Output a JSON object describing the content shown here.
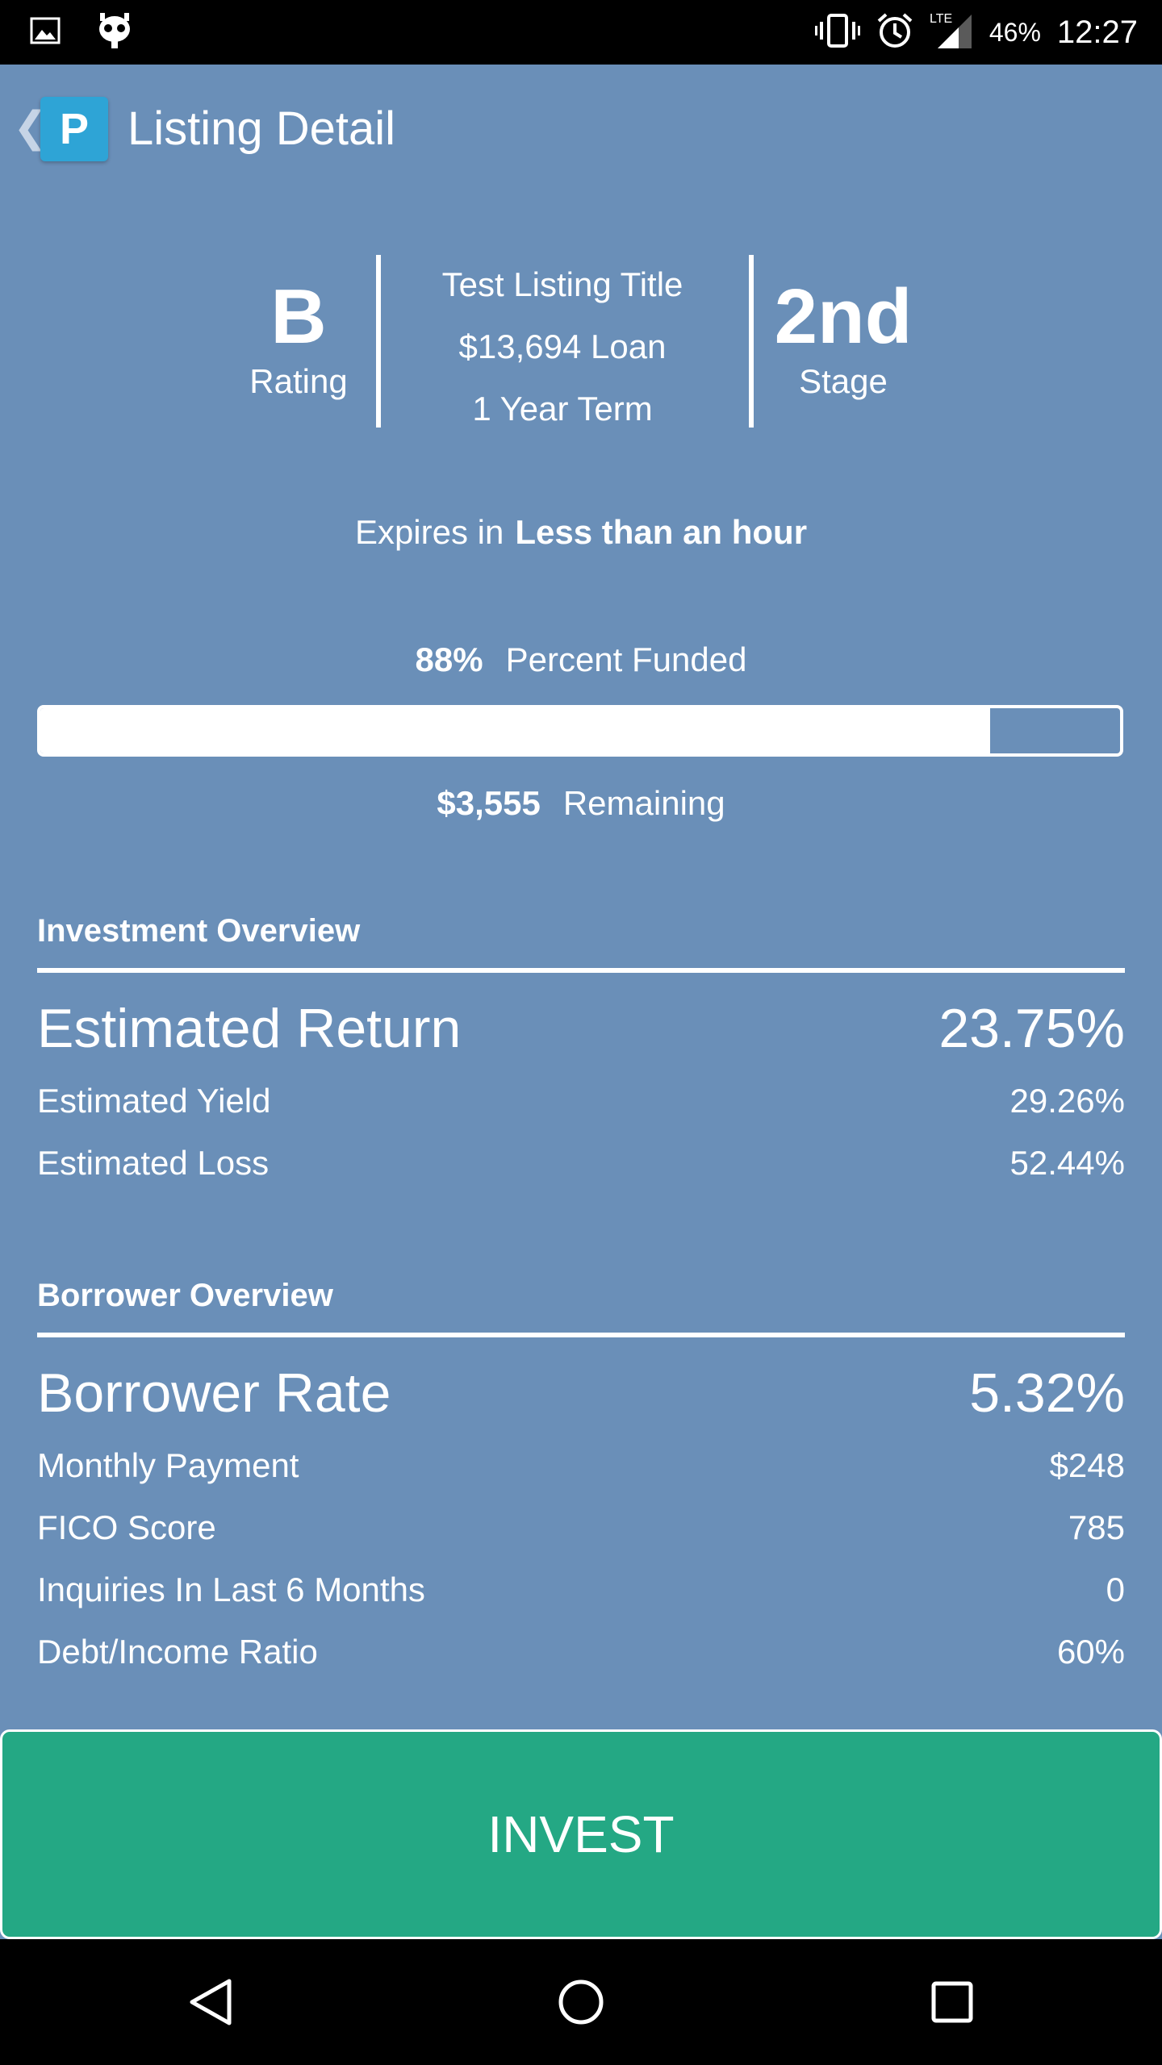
{
  "status_bar": {
    "icons": [
      "image-icon",
      "cyanogen-icon",
      "vibrate-icon",
      "alarm-icon",
      "lte-signal-icon"
    ],
    "network": "LTE",
    "battery": "46%",
    "time": "12:27"
  },
  "app_bar": {
    "logo_letter": "P",
    "title": "Listing Detail"
  },
  "summary": {
    "rating_value": "B",
    "rating_label": "Rating",
    "listing_title": "Test Listing Title",
    "loan_text": "$13,694 Loan",
    "term_text": "1 Year Term",
    "stage_value": "2nd",
    "stage_label": "Stage"
  },
  "expires": {
    "prefix": "Expires in",
    "value": "Less than an hour"
  },
  "funding": {
    "percent_text": "88%",
    "percent_label": "Percent Funded",
    "percent_value": 0.88,
    "remaining_amount": "$3,555",
    "remaining_label": "Remaining"
  },
  "investment_overview": {
    "title": "Investment Overview",
    "headline": {
      "label": "Estimated Return",
      "value": "23.75%"
    },
    "rows": [
      {
        "label": "Estimated Yield",
        "value": "29.26%"
      },
      {
        "label": "Estimated Loss",
        "value": "52.44%"
      }
    ]
  },
  "borrower_overview": {
    "title": "Borrower Overview",
    "headline": {
      "label": "Borrower Rate",
      "value": "5.32%"
    },
    "rows": [
      {
        "label": "Monthly Payment",
        "value": "$248"
      },
      {
        "label": "FICO Score",
        "value": "785"
      },
      {
        "label": "Inquiries In Last 6 Months",
        "value": "0"
      },
      {
        "label": "Debt/Income Ratio",
        "value": "60%"
      }
    ]
  },
  "invest_button": {
    "label": "INVEST"
  },
  "colors": {
    "background": "#6a8fb8",
    "invest_button": "#24a884",
    "logo": "#2ea4d6"
  },
  "nav_bar": {
    "buttons": [
      "back-icon",
      "home-icon",
      "recents-icon"
    ]
  }
}
